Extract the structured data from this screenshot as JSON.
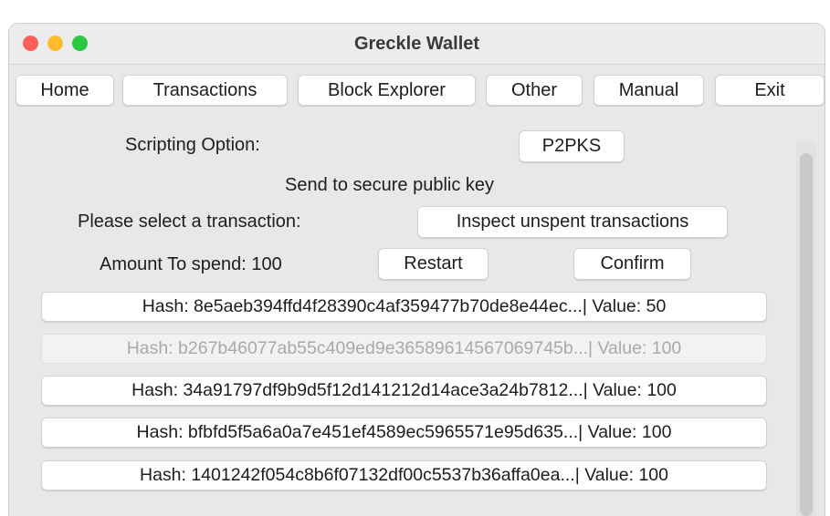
{
  "window": {
    "title": "Greckle Wallet"
  },
  "nav": {
    "home": "Home",
    "transactions": "Transactions",
    "block_explorer": "Block Explorer",
    "other": "Other",
    "manual": "Manual",
    "exit": "Exit"
  },
  "form": {
    "scripting_label": "Scripting Option:",
    "scripting_value": "P2PKS",
    "scripting_description": "Send to secure public key",
    "select_label": "Please select a transaction:",
    "inspect_button": "Inspect unspent transactions",
    "amount_label": "Amount To spend: 100",
    "restart_button": "Restart",
    "confirm_button": "Confirm"
  },
  "transactions": [
    {
      "text": "Hash: 8e5aeb394ffd4f28390c4af359477b70de8e44ec...| Value: 50",
      "enabled": true
    },
    {
      "text": "Hash: b267b46077ab55c409ed9e36589614567069745b...| Value: 100",
      "enabled": false
    },
    {
      "text": "Hash: 34a91797df9b9d5f12d141212d14ace3a24b7812...| Value: 100",
      "enabled": true
    },
    {
      "text": "Hash: bfbfd5f5a6a0a7e451ef4589ec5965571e95d635...| Value: 100",
      "enabled": true
    },
    {
      "text": "Hash: 1401242f054c8b6f07132df00c5537b36affa0ea...| Value: 100",
      "enabled": true
    }
  ],
  "colors": {
    "close": "#ff5f57",
    "minimize": "#febc2e",
    "maximize": "#28c840",
    "window_bg": "#e8e8e8"
  }
}
